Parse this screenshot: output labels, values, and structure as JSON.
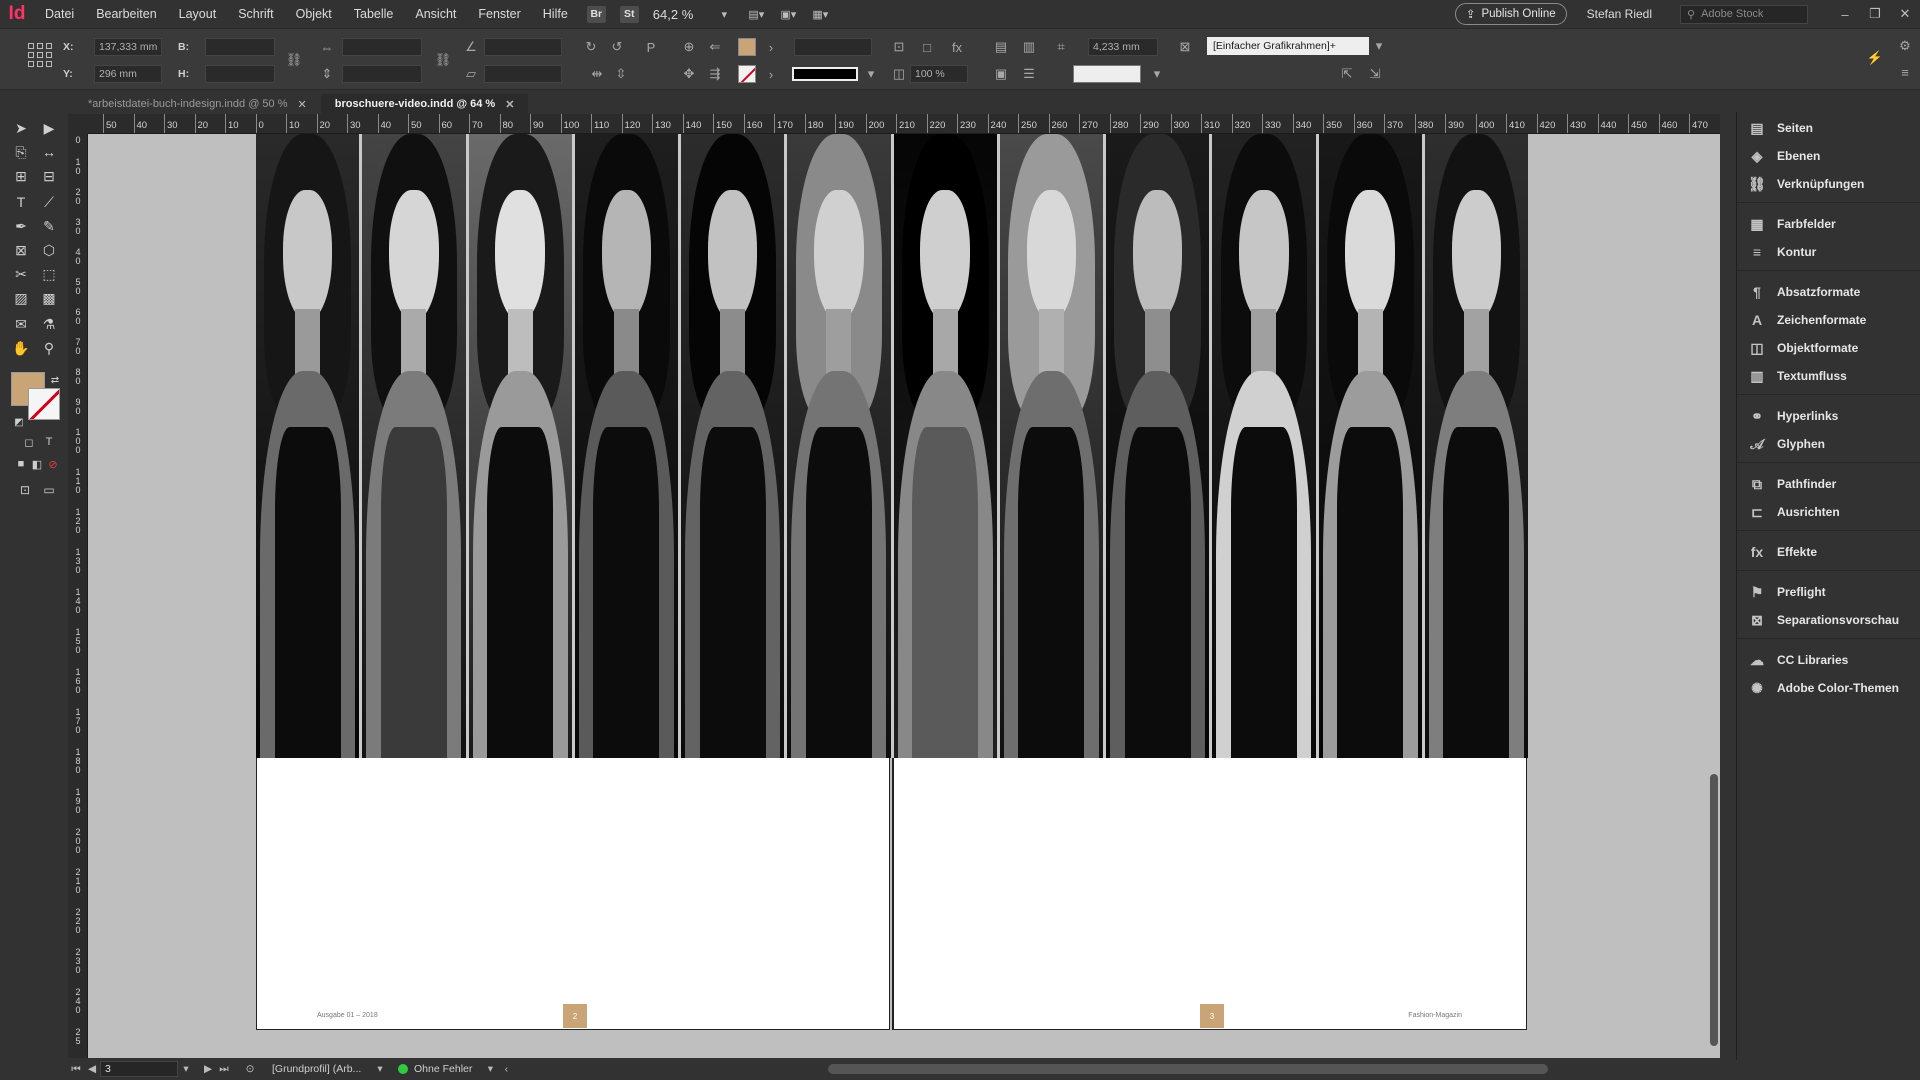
{
  "app": {
    "logo": "Id"
  },
  "menu": {
    "items": [
      "Datei",
      "Bearbeiten",
      "Layout",
      "Schrift",
      "Objekt",
      "Tabelle",
      "Ansicht",
      "Fenster",
      "Hilfe"
    ]
  },
  "appbar": {
    "bridge_label": "Br",
    "stock_label": "St",
    "zoom": "64,2 %",
    "publish_label": "Publish Online",
    "user": "Stefan Riedl",
    "search_placeholder": "Adobe Stock"
  },
  "control": {
    "x_label": "X:",
    "x_value": "137,333 mm",
    "y_label": "Y:",
    "y_value": "296 mm",
    "w_label": "B:",
    "h_label": "H:",
    "scale_value": "100 %",
    "stroke_weight": "4,233 mm",
    "object_style": "[Einfacher Grafikrahmen]+",
    "fill_color": "#c8a476"
  },
  "tabs": [
    {
      "label": "*arbeistdatei-buch-indesign.indd @ 50 %",
      "active": false
    },
    {
      "label": "broschuere-video.indd @ 64 %",
      "active": true
    }
  ],
  "ruler": {
    "h_labels": [
      "50",
      "40",
      "30",
      "20",
      "10",
      "0",
      "10",
      "20",
      "30",
      "40",
      "50",
      "60",
      "70",
      "80",
      "90",
      "100",
      "110",
      "120",
      "130",
      "140",
      "150",
      "160",
      "170",
      "180",
      "190",
      "200",
      "210",
      "220",
      "230",
      "240",
      "250",
      "260",
      "270",
      "280",
      "290",
      "300",
      "310",
      "320",
      "330",
      "340",
      "350",
      "360",
      "370",
      "380",
      "390",
      "400",
      "410",
      "420",
      "430",
      "440",
      "450",
      "460",
      "470"
    ]
  },
  "document": {
    "left_footer": "Ausgabe 01 – 2018",
    "left_page_number": "2",
    "right_page_number": "3",
    "right_footer": "Fashion-Magazin"
  },
  "status": {
    "page": "3",
    "profile": "[Grundprofil] (Arb...",
    "preflight": "Ohne Fehler"
  },
  "panels": [
    {
      "label": "Seiten",
      "icon": "pages-icon"
    },
    {
      "label": "Ebenen",
      "icon": "layers-icon"
    },
    {
      "label": "Verknüpfungen",
      "icon": "links-icon"
    },
    {
      "label": "Farbfelder",
      "icon": "swatches-icon"
    },
    {
      "label": "Kontur",
      "icon": "stroke-icon"
    },
    {
      "label": "Absatzformate",
      "icon": "paragraph-styles-icon"
    },
    {
      "label": "Zeichenformate",
      "icon": "character-styles-icon"
    },
    {
      "label": "Objektformate",
      "icon": "object-styles-icon"
    },
    {
      "label": "Textumfluss",
      "icon": "text-wrap-icon"
    },
    {
      "label": "Hyperlinks",
      "icon": "hyperlinks-icon"
    },
    {
      "label": "Glyphen",
      "icon": "glyphs-icon"
    },
    {
      "label": "Pathfinder",
      "icon": "pathfinder-icon"
    },
    {
      "label": "Ausrichten",
      "icon": "align-icon"
    },
    {
      "label": "Effekte",
      "icon": "effects-icon"
    },
    {
      "label": "Preflight",
      "icon": "preflight-icon"
    },
    {
      "label": "Separationsvorschau",
      "icon": "separations-icon"
    },
    {
      "label": "CC Libraries",
      "icon": "cc-libraries-icon"
    },
    {
      "label": "Adobe Color-Themen",
      "icon": "adobe-color-icon"
    }
  ]
}
